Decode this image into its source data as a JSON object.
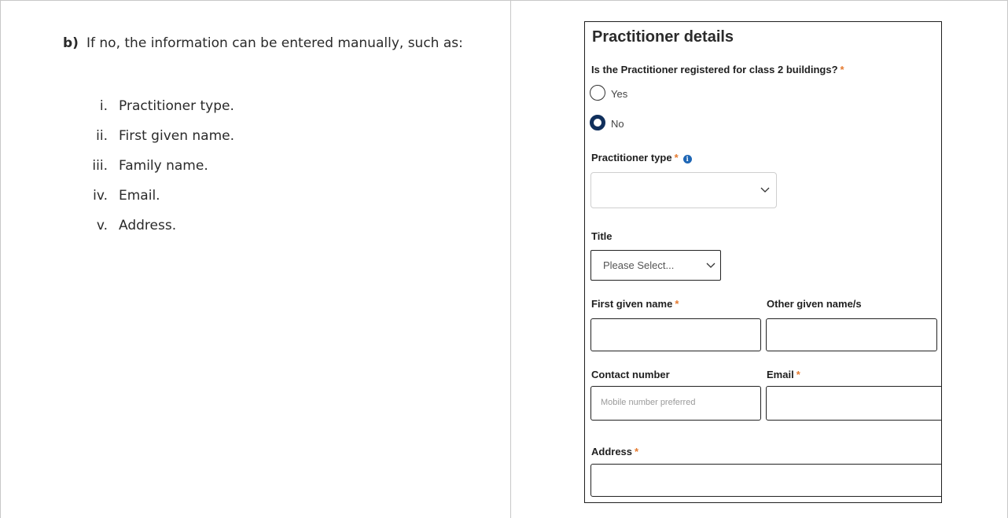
{
  "instructions": {
    "marker": "b)",
    "text": "If no, the information can be entered manually, such as:",
    "items": [
      {
        "num": "i.",
        "text": "Practitioner type."
      },
      {
        "num": "ii.",
        "text": "First given name."
      },
      {
        "num": "iii.",
        "text": "Family name."
      },
      {
        "num": "iv.",
        "text": "Email."
      },
      {
        "num": "v.",
        "text": "Address."
      }
    ]
  },
  "form": {
    "title": "Practitioner details",
    "class2_question": "Is the Practitioner registered for class 2 buildings?",
    "required_mark": "*",
    "radio_yes": "Yes",
    "radio_no": "No",
    "radio_selected": "No",
    "practitioner_type_label": "Practitioner type",
    "info_glyph": "i",
    "practitioner_type_value": "",
    "title_label": "Title",
    "title_select_value": "Please Select...",
    "first_name_label": "First given name",
    "other_names_label": "Other given name/s",
    "contact_label": "Contact number",
    "contact_placeholder": "Mobile number preferred",
    "email_label": "Email",
    "address_label": "Address"
  },
  "colors": {
    "required": "#e57a2f",
    "radio_selected": "#102f5c",
    "info_icon": "#1e66b5",
    "border": "#1f1f1f"
  },
  "icons": [
    "chevron-down-icon",
    "info-icon"
  ]
}
